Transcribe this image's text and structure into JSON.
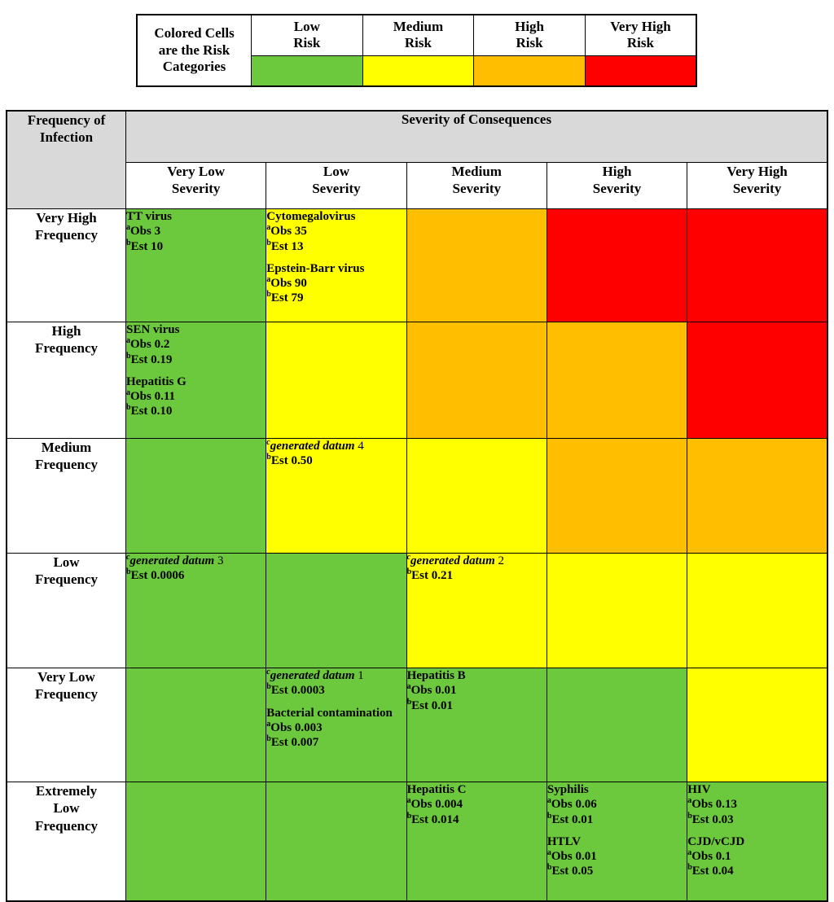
{
  "legend": {
    "caption": "Colored Cells are the Risk Categories",
    "caption_lines": [
      "Colored Cells",
      "are the Risk",
      "Categories"
    ],
    "categories": [
      {
        "label": "Low Risk",
        "line1": "Low",
        "line2": "Risk",
        "color": "#6cc83c",
        "key": "low"
      },
      {
        "label": "Medium Risk",
        "line1": "Medium",
        "line2": "Risk",
        "color": "#ffff00",
        "key": "medium"
      },
      {
        "label": "High Risk",
        "line1": "High",
        "line2": "Risk",
        "color": "#ffbf00",
        "key": "high"
      },
      {
        "label": "Very High Risk",
        "line1": "Very High",
        "line2": "Risk",
        "color": "#ff0000",
        "key": "veryhigh"
      }
    ]
  },
  "matrix": {
    "row_axis_title": "Frequency of Infection",
    "row_axis_title_lines": [
      "Frequency of",
      "Infection"
    ],
    "col_axis_title": "Severity of Consequences",
    "columns": [
      {
        "label": "Very Low Severity",
        "line1": "Very Low",
        "line2": "Severity"
      },
      {
        "label": "Low Severity",
        "line1": "Low",
        "line2": "Severity"
      },
      {
        "label": "Medium Severity",
        "line1": "Medium",
        "line2": "Severity"
      },
      {
        "label": "High Severity",
        "line1": "High",
        "line2": "Severity"
      },
      {
        "label": "Very High Severity",
        "line1": "Very High",
        "line2": "Severity"
      }
    ],
    "rows": [
      {
        "label": "Very High Frequency",
        "label_lines": [
          "Very High",
          "Frequency"
        ],
        "cells": [
          {
            "risk": "low",
            "entries": [
              {
                "name": "TT virus",
                "obs": "Obs 3",
                "est": "Est 10"
              }
            ]
          },
          {
            "risk": "medium",
            "entries": [
              {
                "name": "Cytomegalovirus",
                "obs": "Obs 35",
                "est": "Est 13"
              },
              {
                "name": "Epstein-Barr virus",
                "obs": "Obs 90",
                "est": "Est 79"
              }
            ]
          },
          {
            "risk": "high",
            "entries": []
          },
          {
            "risk": "veryhigh",
            "entries": []
          },
          {
            "risk": "veryhigh",
            "entries": []
          }
        ]
      },
      {
        "label": "High Frequency",
        "label_lines": [
          "High",
          "Frequency"
        ],
        "cells": [
          {
            "risk": "low",
            "entries": [
              {
                "name": "SEN virus",
                "obs": "Obs 0.2",
                "est": "Est 0.19"
              },
              {
                "name": "Hepatitis G",
                "obs": "Obs 0.11",
                "est": "Est 0.10"
              }
            ]
          },
          {
            "risk": "medium",
            "entries": []
          },
          {
            "risk": "high",
            "entries": []
          },
          {
            "risk": "high",
            "entries": []
          },
          {
            "risk": "veryhigh",
            "entries": []
          }
        ]
      },
      {
        "label": "Medium Frequency",
        "label_lines": [
          "Medium",
          "Frequency"
        ],
        "cells": [
          {
            "risk": "low",
            "entries": []
          },
          {
            "risk": "medium",
            "entries": [
              {
                "generated": true,
                "name": "generated datum",
                "gen_num": "4",
                "est": "Est 0.50"
              }
            ]
          },
          {
            "risk": "medium",
            "entries": []
          },
          {
            "risk": "high",
            "entries": []
          },
          {
            "risk": "high",
            "entries": []
          }
        ]
      },
      {
        "label": "Low Frequency",
        "label_lines": [
          "Low",
          "Frequency"
        ],
        "cells": [
          {
            "risk": "low",
            "entries": [
              {
                "generated": true,
                "name": "generated datum",
                "gen_num": "3",
                "est": "Est 0.0006"
              }
            ]
          },
          {
            "risk": "low",
            "entries": []
          },
          {
            "risk": "medium",
            "entries": [
              {
                "generated": true,
                "name": "generated datum",
                "gen_num": "2",
                "est": "Est 0.21"
              }
            ]
          },
          {
            "risk": "medium",
            "entries": []
          },
          {
            "risk": "medium",
            "entries": []
          }
        ]
      },
      {
        "label": "Very Low Frequency",
        "label_lines": [
          "Very Low",
          "Frequency"
        ],
        "cells": [
          {
            "risk": "low",
            "entries": []
          },
          {
            "risk": "low",
            "entries": [
              {
                "generated": true,
                "name": "generated datum",
                "gen_num": "1",
                "est": "Est 0.0003"
              },
              {
                "name": "Bacterial contamination",
                "obs": "Obs 0.003",
                "est": "Est 0.007"
              }
            ]
          },
          {
            "risk": "low",
            "entries": [
              {
                "name": "Hepatitis B",
                "obs": "Obs 0.01",
                "est": "Est 0.01"
              }
            ]
          },
          {
            "risk": "low",
            "entries": []
          },
          {
            "risk": "medium",
            "entries": []
          }
        ]
      },
      {
        "label": "Extremely Low Frequency",
        "label_lines": [
          "Extremely",
          "Low",
          "Frequency"
        ],
        "cells": [
          {
            "risk": "low",
            "entries": []
          },
          {
            "risk": "low",
            "entries": []
          },
          {
            "risk": "low",
            "entries": [
              {
                "name": "Hepatitis C",
                "obs": "Obs 0.004",
                "est": "Est 0.014"
              }
            ]
          },
          {
            "risk": "low",
            "entries": [
              {
                "name": "Syphilis",
                "obs": "Obs 0.06",
                "est": "Est 0.01"
              },
              {
                "name": "HTLV",
                "obs": "Obs 0.01",
                "est": "Est 0.05"
              }
            ]
          },
          {
            "risk": "low",
            "entries": [
              {
                "name": "HIV",
                "obs": "Obs 0.13",
                "est": "Est 0.03"
              },
              {
                "name": "CJD/vCJD",
                "obs": "Obs 0.1",
                "est": "Est 0.04"
              }
            ]
          }
        ]
      }
    ],
    "markers": {
      "obs": "a",
      "est": "b",
      "generated": "c"
    }
  }
}
